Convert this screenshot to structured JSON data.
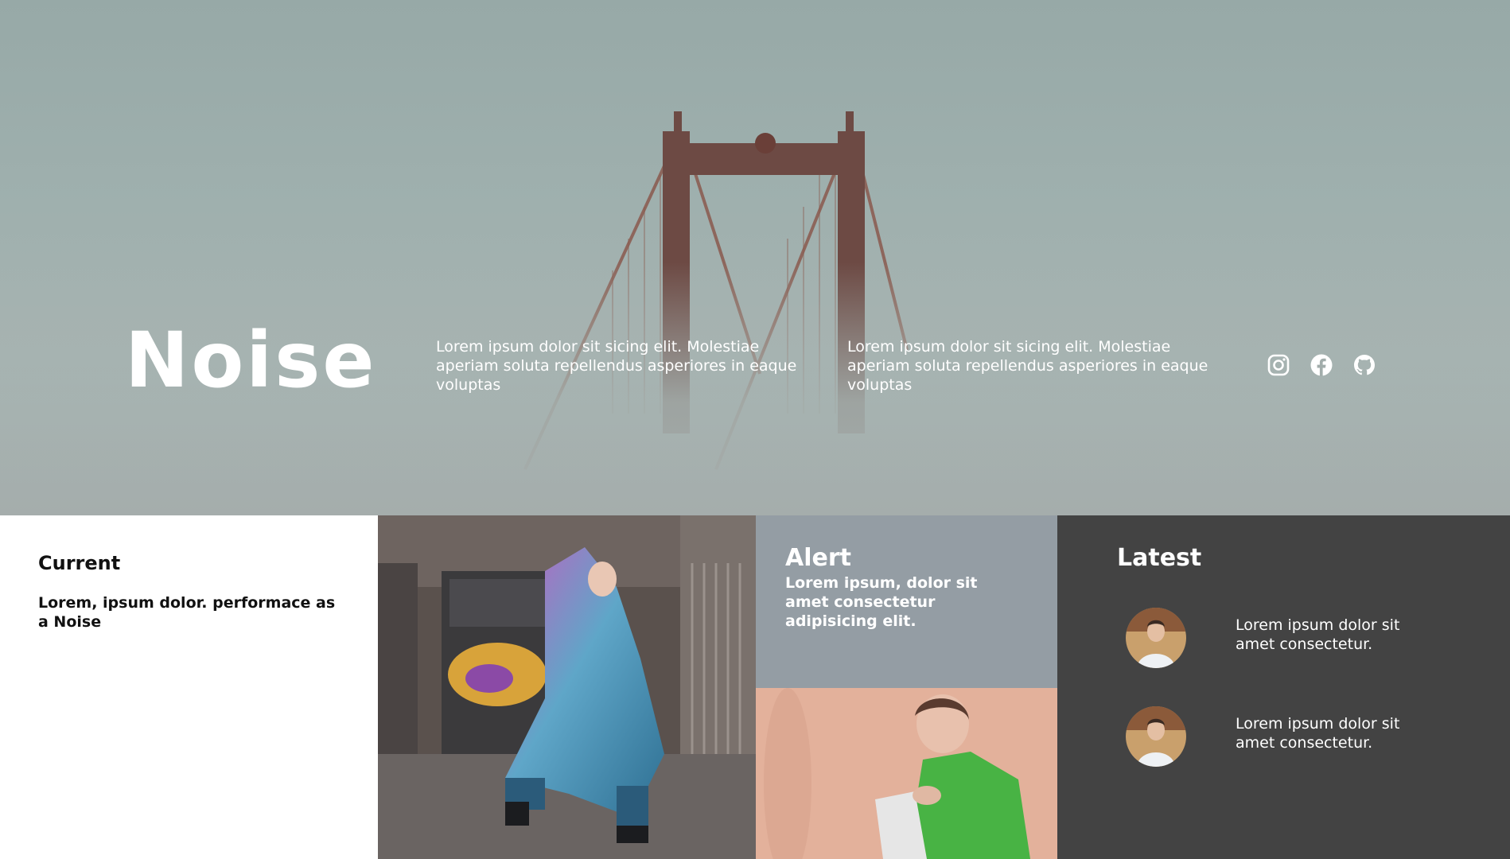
{
  "hero": {
    "title": "Noise",
    "text_1": "Lorem ipsum dolor sit sicing elit. Molestiae aperiam soluta repellendus asperiores in eaque voluptas",
    "text_2": "Lorem ipsum dolor sit sicing elit. Molestiae aperiam soluta repellendus asperiores in eaque voluptas",
    "social_icons": [
      "instagram-icon",
      "facebook-icon",
      "github-icon"
    ]
  },
  "current": {
    "title": "Current",
    "text": "Lorem, ipsum dolor. performace as a Noise"
  },
  "alert": {
    "title": "Alert",
    "text": "Lorem ipsum, dolor sit amet consectetur adipisicing elit."
  },
  "latest": {
    "title": "Latest",
    "items": [
      {
        "text": "Lorem ipsum dolor sit amet consectetur."
      },
      {
        "text": "Lorem ipsum dolor sit amet consectetur."
      }
    ]
  },
  "colors": {
    "hero_bg": "#9fb0ae",
    "alert_bg": "#949da4",
    "latest_bg": "#434343",
    "bridge": "#8a5a4e"
  }
}
